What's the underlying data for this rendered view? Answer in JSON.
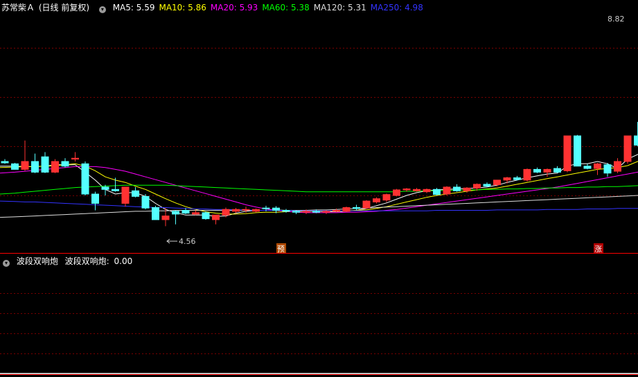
{
  "main_header": {
    "stock_name": "苏常柴Ａ",
    "period": "(日线 前复权)",
    "ma": [
      {
        "label": "MA5:",
        "value": "5.59",
        "color": "#ffffff"
      },
      {
        "label": "MA10:",
        "value": "5.86",
        "color": "#ffff00"
      },
      {
        "label": "MA20:",
        "value": "5.93",
        "color": "#ff00ff"
      },
      {
        "label": "MA60:",
        "value": "5.38",
        "color": "#00ff00"
      },
      {
        "label": "MA120:",
        "value": "5.31",
        "color": "#dddddd"
      },
      {
        "label": "MA250:",
        "value": "4.98",
        "color": "#3333ff"
      }
    ]
  },
  "sub_header": {
    "indicator": "波段双响炮",
    "label": "波段双响炮:",
    "value": "0.00"
  },
  "markers": {
    "low_label": "4.56",
    "high_label": "8.82",
    "yu_badge": "预",
    "zhang_badge": "涨"
  },
  "colors": {
    "up": "#ff3232",
    "down": "#54ffff",
    "grid": "#7a0000",
    "divider": "#ff0000",
    "indicator_line": "#ffffff"
  },
  "chart_data": [
    {
      "type": "candlestick",
      "ylim": [
        4.0,
        9.15
      ],
      "candles": [
        [
          5.95,
          6.0,
          5.9,
          5.92
        ],
        [
          5.9,
          5.92,
          5.78,
          5.78
        ],
        [
          5.78,
          6.4,
          5.75,
          5.95
        ],
        [
          5.95,
          6.12,
          5.7,
          5.72
        ],
        [
          6.05,
          6.15,
          5.7,
          5.72
        ],
        [
          5.72,
          6.0,
          5.7,
          5.95
        ],
        [
          5.95,
          6.02,
          5.82,
          5.85
        ],
        [
          6.0,
          6.15,
          5.95,
          6.02
        ],
        [
          5.9,
          5.95,
          5.22,
          5.25
        ],
        [
          5.25,
          5.3,
          4.9,
          5.05
        ],
        [
          5.4,
          5.45,
          5.22,
          5.35
        ],
        [
          5.35,
          5.6,
          5.3,
          5.32
        ],
        [
          5.05,
          5.4,
          4.98,
          5.4
        ],
        [
          5.32,
          5.4,
          5.18,
          5.2
        ],
        [
          5.2,
          5.25,
          4.92,
          4.95
        ],
        [
          4.96,
          5.0,
          4.7,
          4.7
        ],
        [
          4.7,
          4.95,
          4.56,
          4.78
        ],
        [
          4.88,
          4.9,
          4.6,
          4.82
        ],
        [
          4.9,
          4.95,
          4.82,
          4.84
        ],
        [
          4.82,
          4.9,
          4.8,
          4.85
        ],
        [
          4.85,
          4.88,
          4.7,
          4.72
        ],
        [
          4.7,
          4.8,
          4.6,
          4.8
        ],
        [
          4.8,
          4.96,
          4.75,
          4.92
        ],
        [
          4.88,
          4.95,
          4.84,
          4.92
        ],
        [
          4.92,
          4.98,
          4.85,
          4.92
        ],
        [
          4.88,
          4.94,
          4.85,
          4.92
        ],
        [
          4.95,
          5.0,
          4.88,
          4.94
        ],
        [
          4.95,
          4.99,
          4.84,
          4.9
        ],
        [
          4.9,
          4.93,
          4.85,
          4.88
        ],
        [
          4.88,
          4.9,
          4.82,
          4.86
        ],
        [
          4.86,
          4.92,
          4.82,
          4.88
        ],
        [
          4.88,
          4.92,
          4.84,
          4.86
        ],
        [
          4.86,
          4.9,
          4.82,
          4.88
        ],
        [
          4.88,
          4.94,
          4.86,
          4.9
        ],
        [
          4.88,
          4.98,
          4.86,
          4.96
        ],
        [
          4.96,
          5.02,
          4.9,
          4.94
        ],
        [
          4.95,
          5.12,
          4.93,
          5.1
        ],
        [
          5.08,
          5.18,
          5.05,
          5.15
        ],
        [
          5.12,
          5.26,
          5.08,
          5.24
        ],
        [
          5.22,
          5.36,
          5.2,
          5.34
        ],
        [
          5.34,
          5.38,
          5.3,
          5.36
        ],
        [
          5.32,
          5.38,
          5.3,
          5.35
        ],
        [
          5.3,
          5.37,
          5.27,
          5.35
        ],
        [
          5.35,
          5.38,
          5.22,
          5.24
        ],
        [
          5.25,
          5.42,
          5.22,
          5.4
        ],
        [
          5.4,
          5.46,
          5.3,
          5.32
        ],
        [
          5.32,
          5.4,
          5.28,
          5.38
        ],
        [
          5.38,
          5.48,
          5.32,
          5.46
        ],
        [
          5.46,
          5.5,
          5.4,
          5.42
        ],
        [
          5.45,
          5.55,
          5.42,
          5.55
        ],
        [
          5.55,
          5.62,
          5.48,
          5.6
        ],
        [
          5.6,
          5.64,
          5.54,
          5.56
        ],
        [
          5.55,
          5.8,
          5.52,
          5.78
        ],
        [
          5.78,
          5.82,
          5.7,
          5.72
        ],
        [
          5.72,
          5.8,
          5.62,
          5.78
        ],
        [
          5.8,
          5.85,
          5.7,
          5.72
        ],
        [
          5.75,
          6.5,
          5.72,
          6.5
        ],
        [
          6.5,
          6.52,
          5.85,
          5.85
        ],
        [
          5.85,
          5.9,
          5.78,
          5.8
        ],
        [
          5.8,
          5.92,
          5.66,
          5.9
        ],
        [
          5.88,
          5.92,
          5.62,
          5.7
        ],
        [
          5.74,
          6.02,
          5.7,
          5.95
        ],
        [
          5.95,
          6.5,
          5.9,
          6.5
        ],
        [
          6.5,
          6.8,
          6.28,
          6.3
        ],
        [
          6.3,
          6.44,
          6.25,
          6.4
        ],
        [
          6.48,
          6.82,
          6.45,
          6.8
        ],
        [
          6.8,
          7.6,
          6.78,
          7.1
        ],
        [
          7.1,
          7.3,
          6.95,
          7.0
        ],
        [
          7.2,
          8.6,
          7.15,
          8.2
        ],
        [
          8.85,
          8.9,
          8.2,
          8.6
        ],
        [
          8.82,
          8.85,
          8.1,
          8.15
        ],
        [
          8.1,
          8.2,
          7.95,
          8.05
        ],
        [
          7.95,
          8.1,
          7.7,
          7.75
        ],
        [
          7.7,
          7.9,
          7.55,
          7.6
        ]
      ],
      "ma_lines": {
        "MA5": [
          5.85,
          5.85,
          5.84,
          5.84,
          5.85,
          5.88,
          5.88,
          5.88,
          5.72,
          5.55,
          5.35,
          5.25,
          5.28,
          5.28,
          5.2,
          5.05,
          4.92,
          4.85,
          4.8,
          4.8,
          4.8,
          4.77,
          4.78,
          4.84,
          4.88,
          4.9,
          4.9,
          4.91,
          4.9,
          4.89,
          4.88,
          4.88,
          4.87,
          4.87,
          4.88,
          4.9,
          4.94,
          5.0,
          5.06,
          5.14,
          5.22,
          5.28,
          5.32,
          5.34,
          5.35,
          5.36,
          5.37,
          5.38,
          5.4,
          5.44,
          5.5,
          5.55,
          5.6,
          5.64,
          5.68,
          5.7,
          5.85,
          5.9,
          5.9,
          5.95,
          5.9,
          5.8,
          6.0,
          6.1,
          6.2,
          6.4,
          6.65,
          6.78,
          6.95,
          7.35,
          7.7,
          7.95,
          8.2,
          8.1
        ],
        "MA10": [
          5.82,
          5.83,
          5.84,
          5.84,
          5.85,
          5.86,
          5.88,
          5.9,
          5.85,
          5.75,
          5.62,
          5.55,
          5.5,
          5.42,
          5.35,
          5.25,
          5.15,
          5.06,
          4.98,
          4.92,
          4.87,
          4.84,
          4.82,
          4.82,
          4.83,
          4.85,
          4.86,
          4.86,
          4.87,
          4.87,
          4.88,
          4.88,
          4.88,
          4.88,
          4.89,
          4.9,
          4.91,
          4.94,
          4.98,
          5.03,
          5.08,
          5.13,
          5.18,
          5.22,
          5.25,
          5.28,
          5.31,
          5.34,
          5.36,
          5.38,
          5.42,
          5.46,
          5.5,
          5.54,
          5.58,
          5.62,
          5.66,
          5.7,
          5.74,
          5.78,
          5.8,
          5.82,
          5.86,
          5.95,
          6.02,
          6.1,
          6.2,
          6.32,
          6.45,
          6.62,
          6.85,
          7.05,
          7.25,
          7.45
        ],
        "MA20": [
          5.7,
          5.72,
          5.74,
          5.76,
          5.78,
          5.8,
          5.82,
          5.84,
          5.84,
          5.84,
          5.82,
          5.78,
          5.74,
          5.68,
          5.62,
          5.56,
          5.5,
          5.44,
          5.38,
          5.32,
          5.26,
          5.2,
          5.14,
          5.08,
          5.02,
          4.97,
          4.93,
          4.9,
          4.88,
          4.86,
          4.85,
          4.85,
          4.85,
          4.85,
          4.86,
          4.86,
          4.87,
          4.88,
          4.9,
          4.92,
          4.95,
          4.98,
          5.01,
          5.04,
          5.07,
          5.1,
          5.13,
          5.16,
          5.19,
          5.22,
          5.25,
          5.28,
          5.31,
          5.34,
          5.37,
          5.4,
          5.44,
          5.48,
          5.52,
          5.56,
          5.6,
          5.64,
          5.68,
          5.72,
          5.76,
          5.8,
          5.86,
          5.92,
          6.0,
          6.1,
          6.22,
          6.35,
          6.48,
          6.58
        ],
        "MA60": [
          5.25,
          5.27,
          5.29,
          5.31,
          5.33,
          5.35,
          5.37,
          5.39,
          5.4,
          5.41,
          5.42,
          5.43,
          5.44,
          5.44,
          5.44,
          5.44,
          5.44,
          5.43,
          5.42,
          5.41,
          5.4,
          5.39,
          5.38,
          5.37,
          5.36,
          5.35,
          5.34,
          5.33,
          5.32,
          5.31,
          5.3,
          5.3,
          5.3,
          5.3,
          5.3,
          5.3,
          5.3,
          5.3,
          5.3,
          5.3,
          5.31,
          5.31,
          5.32,
          5.32,
          5.33,
          5.33,
          5.34,
          5.34,
          5.35,
          5.35,
          5.36,
          5.36,
          5.37,
          5.37,
          5.38,
          5.38,
          5.39,
          5.39,
          5.4,
          5.4,
          5.41,
          5.41,
          5.42,
          5.43,
          5.44,
          5.46,
          5.48,
          5.5,
          5.52,
          5.54,
          5.56,
          5.58,
          5.6,
          5.62
        ],
        "MA120": [
          4.75,
          4.76,
          4.77,
          4.78,
          4.79,
          4.8,
          4.81,
          4.82,
          4.83,
          4.84,
          4.85,
          4.86,
          4.87,
          4.88,
          4.88,
          4.89,
          4.89,
          4.9,
          4.9,
          4.9,
          4.9,
          4.9,
          4.9,
          4.9,
          4.9,
          4.9,
          4.9,
          4.9,
          4.9,
          4.9,
          4.9,
          4.91,
          4.91,
          4.92,
          4.93,
          4.94,
          4.95,
          4.96,
          4.97,
          4.98,
          4.99,
          5.0,
          5.01,
          5.02,
          5.03,
          5.04,
          5.05,
          5.06,
          5.07,
          5.08,
          5.09,
          5.1,
          5.11,
          5.12,
          5.13,
          5.14,
          5.15,
          5.16,
          5.17,
          5.18,
          5.19,
          5.2,
          5.21,
          5.22,
          5.23,
          5.24,
          5.25,
          5.26,
          5.27,
          5.28,
          5.29,
          5.3,
          5.31,
          5.31
        ],
        "MA250": [
          5.1,
          5.09,
          5.08,
          5.08,
          5.07,
          5.06,
          5.05,
          5.04,
          5.03,
          5.02,
          5.01,
          5.0,
          4.99,
          4.98,
          4.97,
          4.96,
          4.96,
          4.95,
          4.94,
          4.93,
          4.93,
          4.92,
          4.92,
          4.91,
          4.91,
          4.9,
          4.9,
          4.9,
          4.9,
          4.89,
          4.89,
          4.89,
          4.89,
          4.89,
          4.89,
          4.89,
          4.89,
          4.89,
          4.89,
          4.89,
          4.89,
          4.89,
          4.89,
          4.9,
          4.9,
          4.9,
          4.9,
          4.9,
          4.9,
          4.91,
          4.91,
          4.91,
          4.91,
          4.91,
          4.92,
          4.92,
          4.92,
          4.92,
          4.93,
          4.93,
          4.93,
          4.94,
          4.94,
          4.94,
          4.95,
          4.95,
          4.95,
          4.96,
          4.96,
          4.96,
          4.97,
          4.97,
          4.98,
          4.98
        ]
      }
    },
    {
      "type": "line",
      "name": "波段双响炮",
      "ylim": [
        0,
        1
      ],
      "values": [
        0,
        0,
        0,
        0,
        0,
        0,
        0,
        0,
        0,
        0,
        0,
        0,
        0,
        0,
        0,
        0,
        0,
        0,
        0,
        0,
        0,
        0,
        0,
        0,
        0,
        0,
        0,
        0,
        0,
        0,
        0,
        0,
        0,
        0,
        0,
        0,
        0,
        0,
        0,
        0,
        0,
        0,
        0,
        0,
        0,
        0,
        0,
        0,
        0,
        0,
        0,
        0,
        0,
        0,
        0,
        0,
        0,
        0,
        0,
        0,
        0,
        0,
        0,
        0,
        0,
        1,
        1,
        0,
        0,
        1,
        0,
        0,
        0,
        0
      ]
    }
  ]
}
